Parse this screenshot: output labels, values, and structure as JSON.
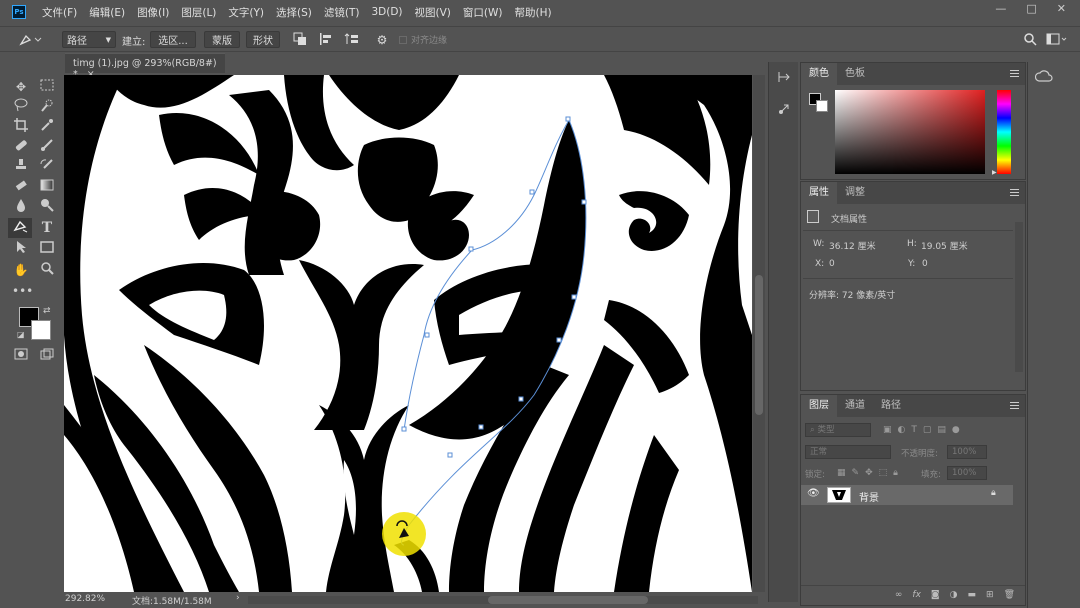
{
  "menubar": {
    "logo": "Ps",
    "items": [
      "文件(F)",
      "编辑(E)",
      "图像(I)",
      "图层(L)",
      "文字(Y)",
      "选择(S)",
      "滤镜(T)",
      "3D(D)",
      "视图(V)",
      "窗口(W)",
      "帮助(H)"
    ],
    "window_controls": [
      "—",
      "□",
      "✕"
    ]
  },
  "options": {
    "mode_select": "路径",
    "build_label": "建立:",
    "selection_button": "选区...",
    "mask_button": "蒙版",
    "shape_button": "形状",
    "align_edges": "对齐边缘"
  },
  "document": {
    "tab_title": "timg (1).jpg @ 293%(RGB/8#) *",
    "zoom": "292.82%",
    "doc_size": "文档:1.58M/1.58M"
  },
  "color_panel": {
    "tabs": [
      "颜色",
      "色板"
    ],
    "foreground": "#000000",
    "background": "#ffffff"
  },
  "properties_panel": {
    "tabs": [
      "属性",
      "调整"
    ],
    "section": "文档属性",
    "w_label": "W:",
    "w_value": "36.12 厘米",
    "h_label": "H:",
    "h_value": "19.05 厘米",
    "x_label": "X:",
    "x_value": "0",
    "y_label": "Y:",
    "y_value": "0",
    "resolution": "分辨率: 72 像素/英寸"
  },
  "layers_panel": {
    "tabs": [
      "图层",
      "通道",
      "路径"
    ],
    "filter_placeholder": "类型",
    "blend_mode": "正常",
    "opacity_label": "不透明度:",
    "opacity_value": "100%",
    "lock_label": "锁定:",
    "fill_label": "填充:",
    "fill_value": "100%",
    "layers": [
      {
        "name": "背景",
        "visible": true,
        "locked": true
      }
    ],
    "footer_icons": [
      "link-icon",
      "fx-icon",
      "mask-icon",
      "adjustment-icon",
      "folder-icon",
      "new-layer-icon",
      "trash-icon"
    ]
  },
  "colors": {
    "app_bg": "#535353",
    "panel_dark": "#474747",
    "ps_blue": "#31a8ff",
    "path_blue": "#5b8fd6",
    "cursor_highlight": "#f0e000"
  }
}
